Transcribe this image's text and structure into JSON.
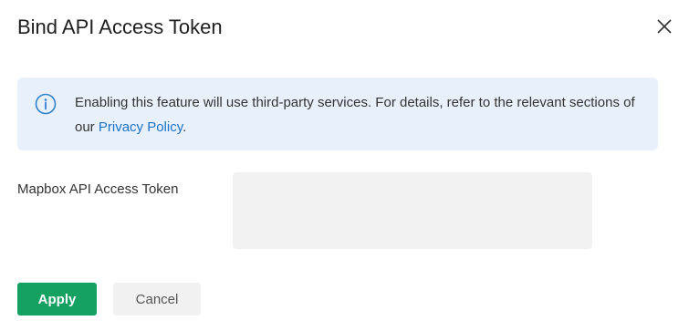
{
  "dialog": {
    "title": "Bind API Access Token",
    "close_icon": "close-icon"
  },
  "notice": {
    "icon": "info-icon",
    "text_before_link": "Enabling this feature will use third-party services. For details, refer to the relevant sections of our ",
    "link_text": "Privacy Policy",
    "text_after_link": "."
  },
  "form": {
    "token_label": "Mapbox API Access Token",
    "token_value": "",
    "token_placeholder": ""
  },
  "actions": {
    "apply_label": "Apply",
    "cancel_label": "Cancel"
  },
  "colors": {
    "primary": "#14a161",
    "notice_background": "#e8f1fb",
    "link": "#1a73c9",
    "info_icon": "#2f7fd1"
  }
}
